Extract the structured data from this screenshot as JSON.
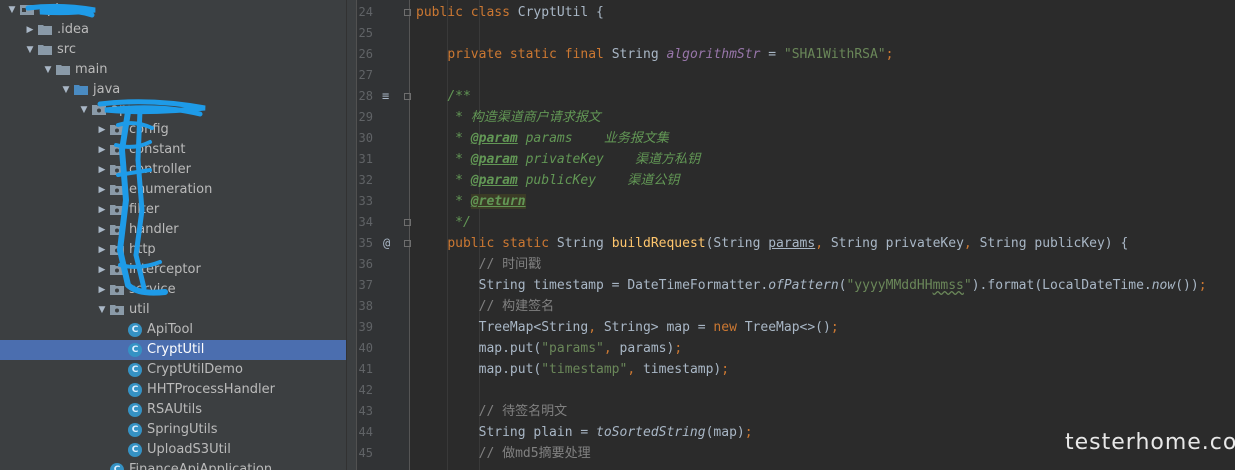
{
  "project_tree": [
    {
      "label": "api",
      "depth": 0,
      "arrow": "down",
      "icon": "module",
      "redacted": true
    },
    {
      "label": ".idea",
      "depth": 1,
      "arrow": "right",
      "icon": "folder"
    },
    {
      "label": "src",
      "depth": 1,
      "arrow": "down",
      "icon": "folder"
    },
    {
      "label": "main",
      "depth": 2,
      "arrow": "down",
      "icon": "folder"
    },
    {
      "label": "java",
      "depth": 3,
      "arrow": "down",
      "icon": "folder-src"
    },
    {
      "label": "api",
      "depth": 4,
      "arrow": "down",
      "icon": "package",
      "redacted": true
    },
    {
      "label": "config",
      "depth": 5,
      "arrow": "right",
      "icon": "package"
    },
    {
      "label": "constant",
      "depth": 5,
      "arrow": "right",
      "icon": "package"
    },
    {
      "label": "controller",
      "depth": 5,
      "arrow": "right",
      "icon": "package"
    },
    {
      "label": "enumeration",
      "depth": 5,
      "arrow": "right",
      "icon": "package"
    },
    {
      "label": "filter",
      "depth": 5,
      "arrow": "right",
      "icon": "package"
    },
    {
      "label": "handler",
      "depth": 5,
      "arrow": "right",
      "icon": "package"
    },
    {
      "label": "http",
      "depth": 5,
      "arrow": "right",
      "icon": "package"
    },
    {
      "label": "interceptor",
      "depth": 5,
      "arrow": "right",
      "icon": "package"
    },
    {
      "label": "service",
      "depth": 5,
      "arrow": "right",
      "icon": "package"
    },
    {
      "label": "util",
      "depth": 5,
      "arrow": "down",
      "icon": "package"
    },
    {
      "label": "ApiTool",
      "depth": 6,
      "arrow": "",
      "icon": "class"
    },
    {
      "label": "CryptUtil",
      "depth": 6,
      "arrow": "",
      "icon": "class",
      "selected": true
    },
    {
      "label": "CryptUtilDemo",
      "depth": 6,
      "arrow": "",
      "icon": "class"
    },
    {
      "label": "HHTProcessHandler",
      "depth": 6,
      "arrow": "",
      "icon": "class"
    },
    {
      "label": "RSAUtils",
      "depth": 6,
      "arrow": "",
      "icon": "class"
    },
    {
      "label": "SpringUtils",
      "depth": 6,
      "arrow": "",
      "icon": "class"
    },
    {
      "label": "UploadS3Util",
      "depth": 6,
      "arrow": "",
      "icon": "class"
    },
    {
      "label": "FinanceApiApplication",
      "depth": 5,
      "arrow": "",
      "icon": "class-app"
    }
  ],
  "gutter": {
    "line_numbers": [
      "24",
      "25",
      "26",
      "27",
      "28",
      "29",
      "30",
      "31",
      "32",
      "33",
      "34",
      "35",
      "36",
      "37",
      "38",
      "39",
      "40",
      "41",
      "42",
      "43",
      "44",
      "45"
    ],
    "override_marker": "@",
    "doc_marker": "≡"
  },
  "code_lines": [
    [
      [
        "kw",
        "public class "
      ],
      [
        "plain",
        "CryptUtil {"
      ]
    ],
    [],
    [
      [
        "plain",
        "    "
      ],
      [
        "kw",
        "private static final "
      ],
      [
        "plain",
        "String "
      ],
      [
        "fld",
        "algorithmStr"
      ],
      [
        "plain",
        " = "
      ],
      [
        "str",
        "\"SHA1WithRSA\""
      ],
      [
        "kw",
        ";"
      ]
    ],
    [],
    [
      [
        "plain",
        "    "
      ],
      [
        "doc",
        "/**"
      ]
    ],
    [
      [
        "plain",
        "     "
      ],
      [
        "doc",
        "* 构造渠道商户请求报文"
      ]
    ],
    [
      [
        "plain",
        "     "
      ],
      [
        "doc",
        "* "
      ],
      [
        "tag",
        "@param"
      ],
      [
        "doc",
        " params    业务报文集"
      ]
    ],
    [
      [
        "plain",
        "     "
      ],
      [
        "doc",
        "* "
      ],
      [
        "tag",
        "@param"
      ],
      [
        "doc",
        " privateKey    渠道方私钥"
      ]
    ],
    [
      [
        "plain",
        "     "
      ],
      [
        "doc",
        "* "
      ],
      [
        "tag",
        "@param"
      ],
      [
        "doc",
        " publicKey    渠道公钥"
      ]
    ],
    [
      [
        "plain",
        "     "
      ],
      [
        "doc",
        "* "
      ],
      [
        "tag tagbg",
        "@return"
      ]
    ],
    [
      [
        "plain",
        "     "
      ],
      [
        "doc",
        "*/"
      ]
    ],
    [
      [
        "plain",
        "    "
      ],
      [
        "kw",
        "public static "
      ],
      [
        "plain",
        "String "
      ],
      [
        "fn",
        "buildRequest"
      ],
      [
        "plain",
        "(String "
      ],
      [
        "und",
        "params"
      ],
      [
        "kw",
        ", "
      ],
      [
        "plain",
        "String privateKey"
      ],
      [
        "kw",
        ", "
      ],
      [
        "plain",
        "String publicKey) {"
      ]
    ],
    [
      [
        "plain",
        "        "
      ],
      [
        "cmt",
        "// 时间戳"
      ]
    ],
    [
      [
        "plain",
        "        String timestamp = DateTimeFormatter."
      ],
      [
        "ital",
        "ofPattern"
      ],
      [
        "plain",
        "("
      ],
      [
        "str",
        "\"yyyyMMddHH"
      ],
      [
        "str wavy",
        "mmss"
      ],
      [
        "str",
        "\""
      ],
      [
        "plain",
        ").format(LocalDateTime."
      ],
      [
        "ital",
        "now"
      ],
      [
        "plain",
        "())"
      ],
      [
        "kw",
        ";"
      ]
    ],
    [
      [
        "plain",
        "        "
      ],
      [
        "cmt",
        "// 构建签名"
      ]
    ],
    [
      [
        "plain",
        "        TreeMap<String"
      ],
      [
        "kw",
        ", "
      ],
      [
        "plain",
        "String> map = "
      ],
      [
        "kw",
        "new "
      ],
      [
        "plain",
        "TreeMap<>()"
      ],
      [
        "kw",
        ";"
      ]
    ],
    [
      [
        "plain",
        "        map.put("
      ],
      [
        "str",
        "\"params\""
      ],
      [
        "kw",
        ", "
      ],
      [
        "plain",
        "params)"
      ],
      [
        "kw",
        ";"
      ]
    ],
    [
      [
        "plain",
        "        map.put("
      ],
      [
        "str",
        "\"timestamp\""
      ],
      [
        "kw",
        ", "
      ],
      [
        "plain",
        "timestamp)"
      ],
      [
        "kw",
        ";"
      ]
    ],
    [],
    [
      [
        "plain",
        "        "
      ],
      [
        "cmt",
        "// 待签名明文"
      ]
    ],
    [
      [
        "plain",
        "        String plain = "
      ],
      [
        "ital",
        "toSortedString"
      ],
      [
        "plain",
        "(map)"
      ],
      [
        "kw",
        ";"
      ]
    ],
    [
      [
        "plain",
        "        "
      ],
      [
        "cmt",
        "// 做md5摘要处理"
      ]
    ]
  ],
  "watermark": "testerhome.com",
  "colors": {
    "panel_bg": "#3c3f41",
    "editor_bg": "#2b2b2b",
    "selection": "#4b6eaf",
    "keyword": "#cc7832",
    "string": "#6a8759",
    "doc": "#629755",
    "field": "#9876aa",
    "method": "#ffc66d",
    "redaction_scribble": "#1e9be8"
  }
}
